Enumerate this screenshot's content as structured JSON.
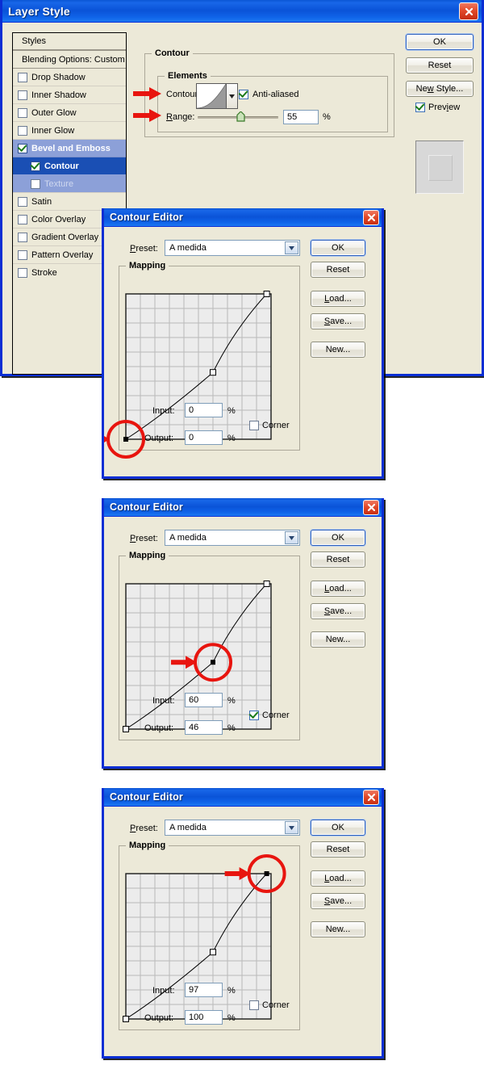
{
  "layer_style": {
    "title": "Layer Style",
    "close_icon": "close-icon",
    "styles_list": [
      {
        "label": "Styles",
        "type": "header"
      },
      {
        "label": "Blending Options: Custom",
        "type": "header"
      },
      {
        "label": "Drop Shadow",
        "checked": false
      },
      {
        "label": "Inner Shadow",
        "checked": false
      },
      {
        "label": "Outer Glow",
        "checked": false
      },
      {
        "label": "Inner Glow",
        "checked": false
      },
      {
        "label": "Bevel and Emboss",
        "checked": true,
        "state": "selected-parent"
      },
      {
        "label": "Contour",
        "checked": true,
        "state": "selected",
        "sub": true
      },
      {
        "label": "Texture",
        "checked": false,
        "state": "dimmed",
        "sub": true
      },
      {
        "label": "Satin",
        "checked": false
      },
      {
        "label": "Color Overlay",
        "checked": false
      },
      {
        "label": "Gradient Overlay",
        "checked": false
      },
      {
        "label": "Pattern Overlay",
        "checked": false
      },
      {
        "label": "Stroke",
        "checked": false
      }
    ],
    "contour_group_label": "Contour",
    "elements_group_label": "Elements",
    "contour_label": "Contour:",
    "anti_aliased_label": "Anti-aliased",
    "anti_aliased_checked": true,
    "range_label": "Range:",
    "range_value": "55",
    "range_percent": "%",
    "range_slider_position_pct": 55,
    "buttons": {
      "ok": "OK",
      "reset": "Reset",
      "new_style": "New Style..."
    },
    "preview_label": "Preview",
    "preview_checked": true
  },
  "contour_editors": [
    {
      "title": "Contour Editor",
      "preset_label": "Preset:",
      "preset_value": "A medida",
      "mapping_label": "Mapping",
      "input_label": "Input:",
      "input_value": "0",
      "output_label": "Output:",
      "output_value": "0",
      "percent": "%",
      "corner_label": "Corner",
      "corner_checked": false,
      "buttons": {
        "ok": "OK",
        "reset": "Reset",
        "load": "Load...",
        "save": "Save...",
        "new": "New..."
      },
      "selected_point_index": 0,
      "highlight": {
        "x_pct": 0,
        "y_pct": 0
      }
    },
    {
      "title": "Contour Editor",
      "preset_label": "Preset:",
      "preset_value": "A medida",
      "mapping_label": "Mapping",
      "input_label": "Input:",
      "input_value": "60",
      "output_label": "Output:",
      "output_value": "46",
      "percent": "%",
      "corner_label": "Corner",
      "corner_checked": true,
      "buttons": {
        "ok": "OK",
        "reset": "Reset",
        "load": "Load...",
        "save": "Save...",
        "new": "New..."
      },
      "selected_point_index": 1,
      "highlight": {
        "x_pct": 60,
        "y_pct": 46
      }
    },
    {
      "title": "Contour Editor",
      "preset_label": "Preset:",
      "preset_value": "A medida",
      "mapping_label": "Mapping",
      "input_label": "Input:",
      "input_value": "97",
      "output_label": "Output:",
      "output_value": "100",
      "percent": "%",
      "corner_label": "Corner",
      "corner_checked": false,
      "buttons": {
        "ok": "OK",
        "reset": "Reset",
        "load": "Load...",
        "save": "Save...",
        "new": "New..."
      },
      "selected_point_index": 2,
      "highlight": {
        "x_pct": 97,
        "y_pct": 100
      }
    }
  ],
  "chart_data": {
    "type": "line",
    "title": "Contour mapping curve",
    "xlabel": "Input (%)",
    "ylabel": "Output (%)",
    "xlim": [
      0,
      100
    ],
    "ylim": [
      0,
      100
    ],
    "grid": true,
    "grid_divisions": 10,
    "legend": "none",
    "control_points": [
      {
        "input": 0,
        "output": 0,
        "corner": false
      },
      {
        "input": 60,
        "output": 46,
        "corner": true
      },
      {
        "input": 97,
        "output": 100,
        "corner": false
      }
    ],
    "series": [
      {
        "name": "Contour",
        "x": [
          0,
          60,
          97,
          100
        ],
        "y": [
          0,
          46,
          100,
          100
        ]
      }
    ]
  },
  "colors": {
    "title_blue": "#0a53d8",
    "window_border": "#0a2ed4",
    "face": "#ece9d8",
    "selection_light": "#8ca0d8",
    "selection_dark": "#1a4fb4",
    "annotation_red": "#e8150f",
    "check_green": "#1a7a1a"
  }
}
